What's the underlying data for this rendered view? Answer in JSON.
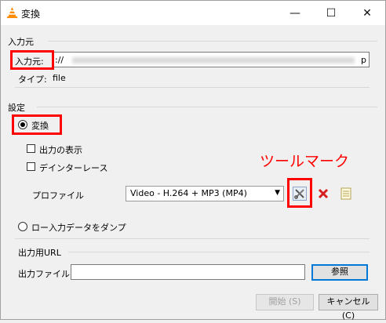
{
  "window": {
    "title": "変換",
    "minimize_glyph": "—",
    "maximize_glyph": "☐",
    "close_glyph": "✕"
  },
  "source": {
    "group_title": "入力元",
    "input_label": "入力元:",
    "input_value_prefix": "://",
    "input_value_suffix": "p",
    "type_label": "タイプ:",
    "type_value": "file"
  },
  "settings": {
    "group_title": "設定",
    "convert_label": "変換",
    "show_output_label": "出力の表示",
    "deinterlace_label": "デインターレース",
    "profile_label": "プロファイル",
    "profile_selected": "Video - H.264 + MP3 (MP4)",
    "dump_label": "ロー入力データをダンプ"
  },
  "annotation": {
    "text": "ツールマーク",
    "color": "#ff0000"
  },
  "output": {
    "group_title": "出力用URL",
    "file_label": "出力ファイル:",
    "file_value": "",
    "browse_label": "参照"
  },
  "footer": {
    "start_label": "開始 (S)",
    "cancel_label": "キャンセル (C)"
  },
  "icons": {
    "app": "vlc-cone-icon",
    "tools": "wrench-screwdriver-icon",
    "delete": "red-x-icon",
    "new": "document-icon",
    "dropdown": "chevron-down-icon"
  }
}
